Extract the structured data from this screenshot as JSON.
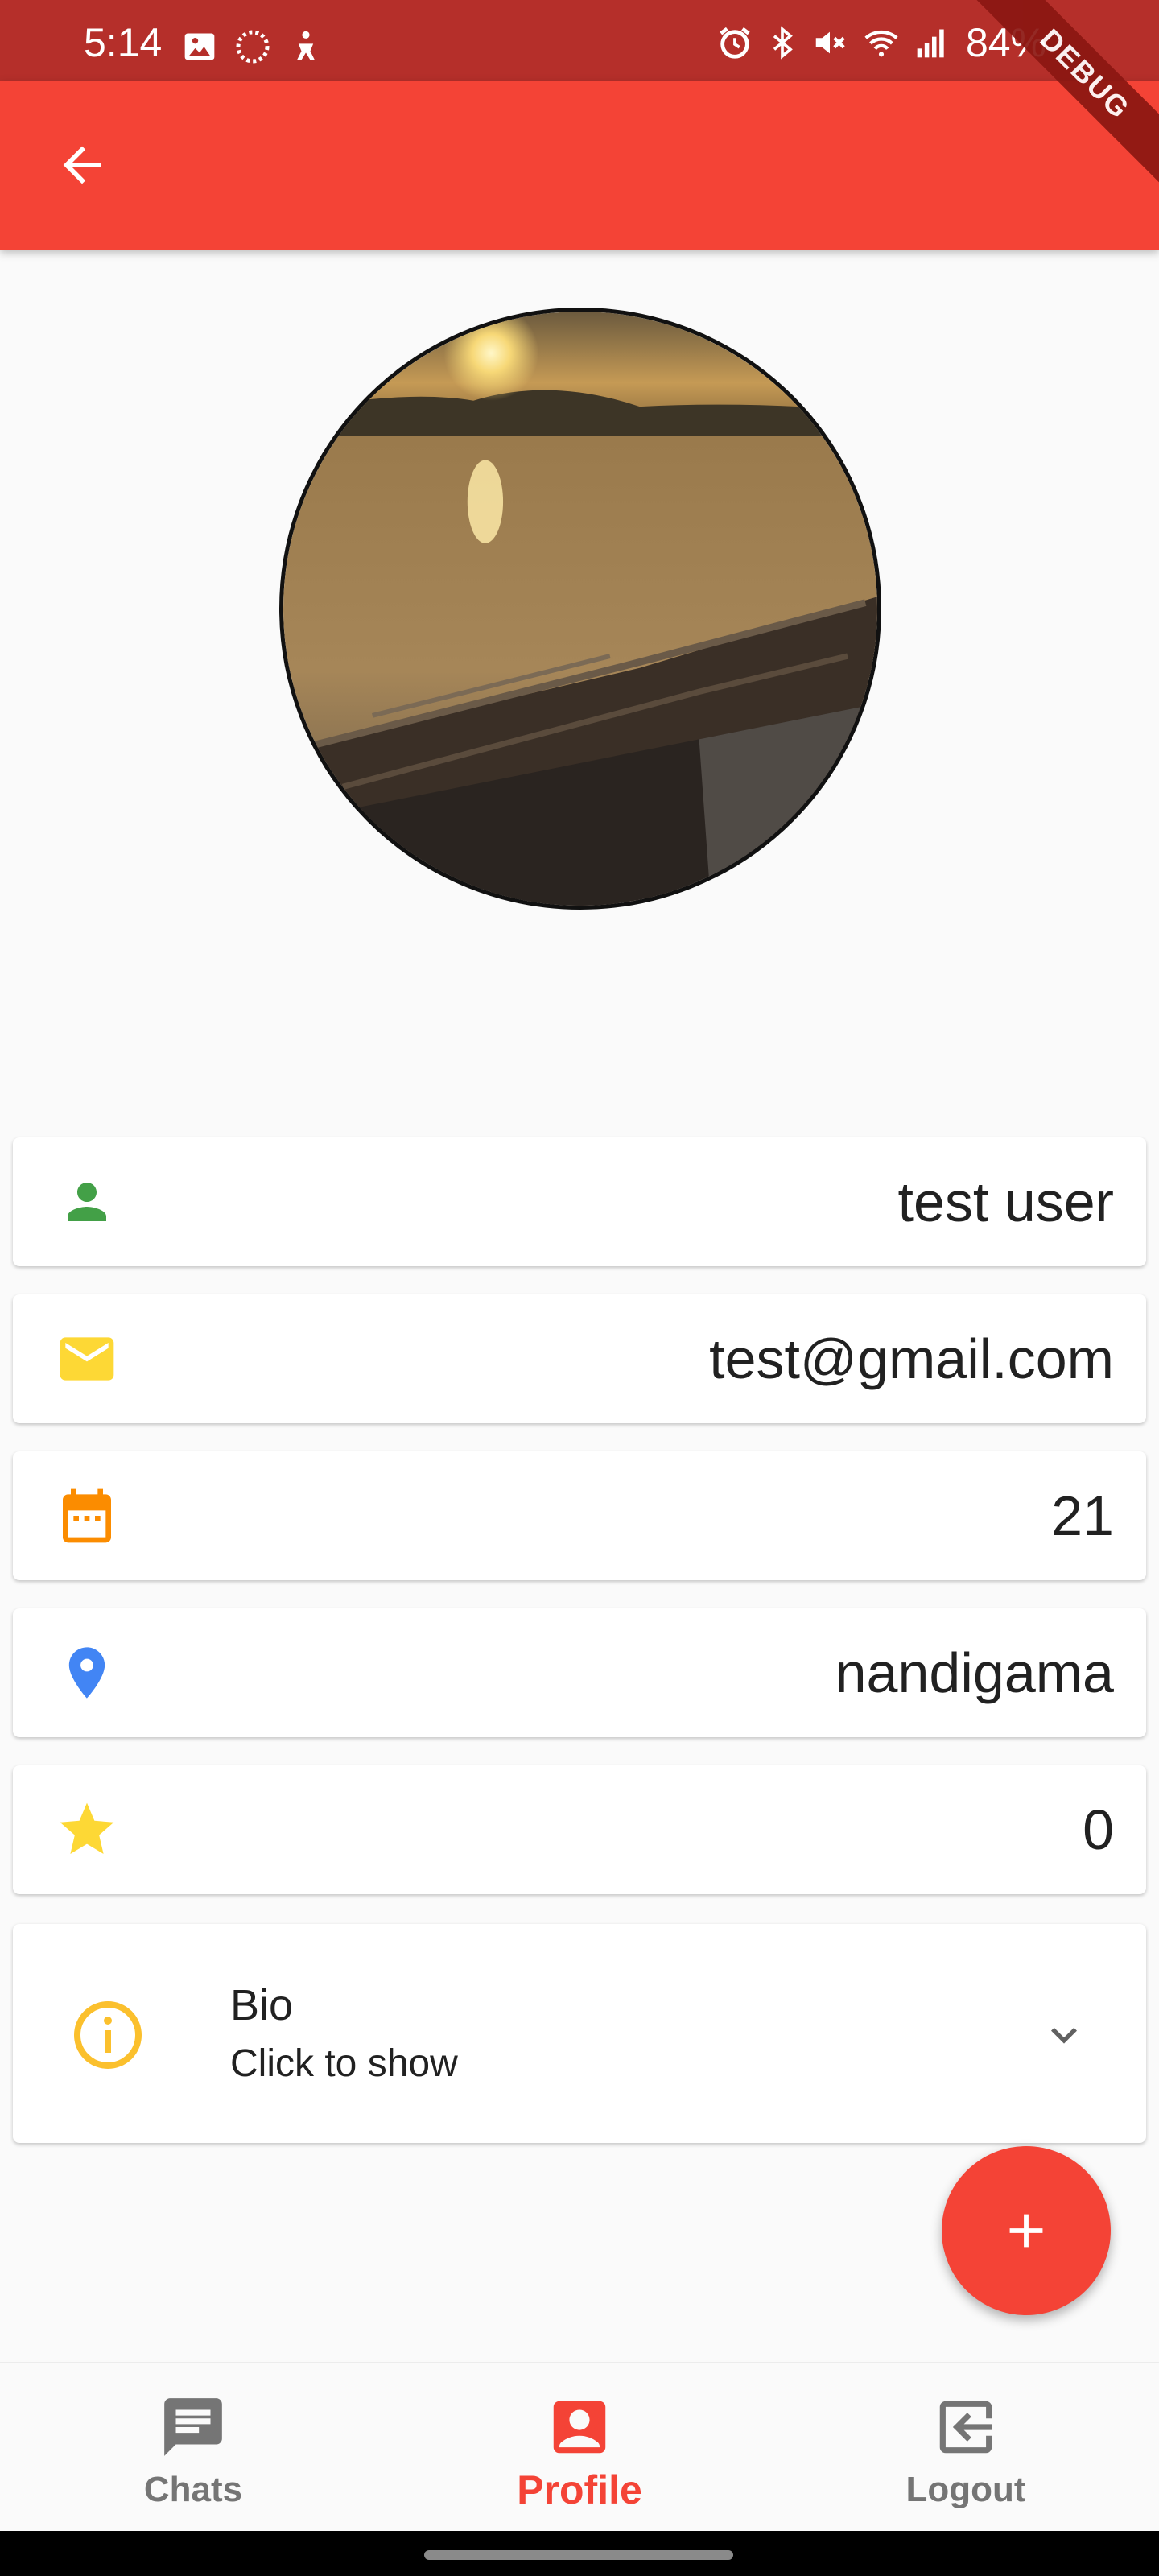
{
  "status_bar": {
    "time": "5:14",
    "battery": "84%",
    "left_icons": [
      "gallery-icon",
      "sync-icon",
      "accessibility-icon"
    ],
    "right_icons": [
      "alarm-icon",
      "bluetooth-icon",
      "mute-icon",
      "wifi-icon",
      "signal-icon"
    ],
    "debug_label": "DEBUG"
  },
  "app_bar": {
    "back_icon": "arrow-back-icon",
    "color": "#f44336"
  },
  "profile": {
    "avatar": "sunset-lake-boat-photo",
    "fields": [
      {
        "name": "name",
        "icon": "person-icon",
        "icon_color": "#43a047",
        "value": "test user"
      },
      {
        "name": "email",
        "icon": "mail-icon",
        "icon_color": "#fdd835",
        "value": "test@gmail.com"
      },
      {
        "name": "age",
        "icon": "calendar-icon",
        "icon_color": "#fb8c00",
        "value": "21"
      },
      {
        "name": "location",
        "icon": "location-pin-icon",
        "icon_color": "#4285f4",
        "value": "nandigama"
      },
      {
        "name": "rating",
        "icon": "star-icon",
        "icon_color": "#fdd835",
        "value": "0"
      }
    ],
    "bio": {
      "icon": "info-icon",
      "title": "Bio",
      "subtitle": "Click to show",
      "expand_icon": "chevron-down-icon"
    }
  },
  "fab": {
    "icon": "plus-icon",
    "color": "#f44336"
  },
  "bottom_nav": {
    "items": [
      {
        "label": "Chats",
        "icon": "chat-icon",
        "active": false
      },
      {
        "label": "Profile",
        "icon": "account-box-icon",
        "active": true
      },
      {
        "label": "Logout",
        "icon": "logout-icon",
        "active": false
      }
    ]
  }
}
